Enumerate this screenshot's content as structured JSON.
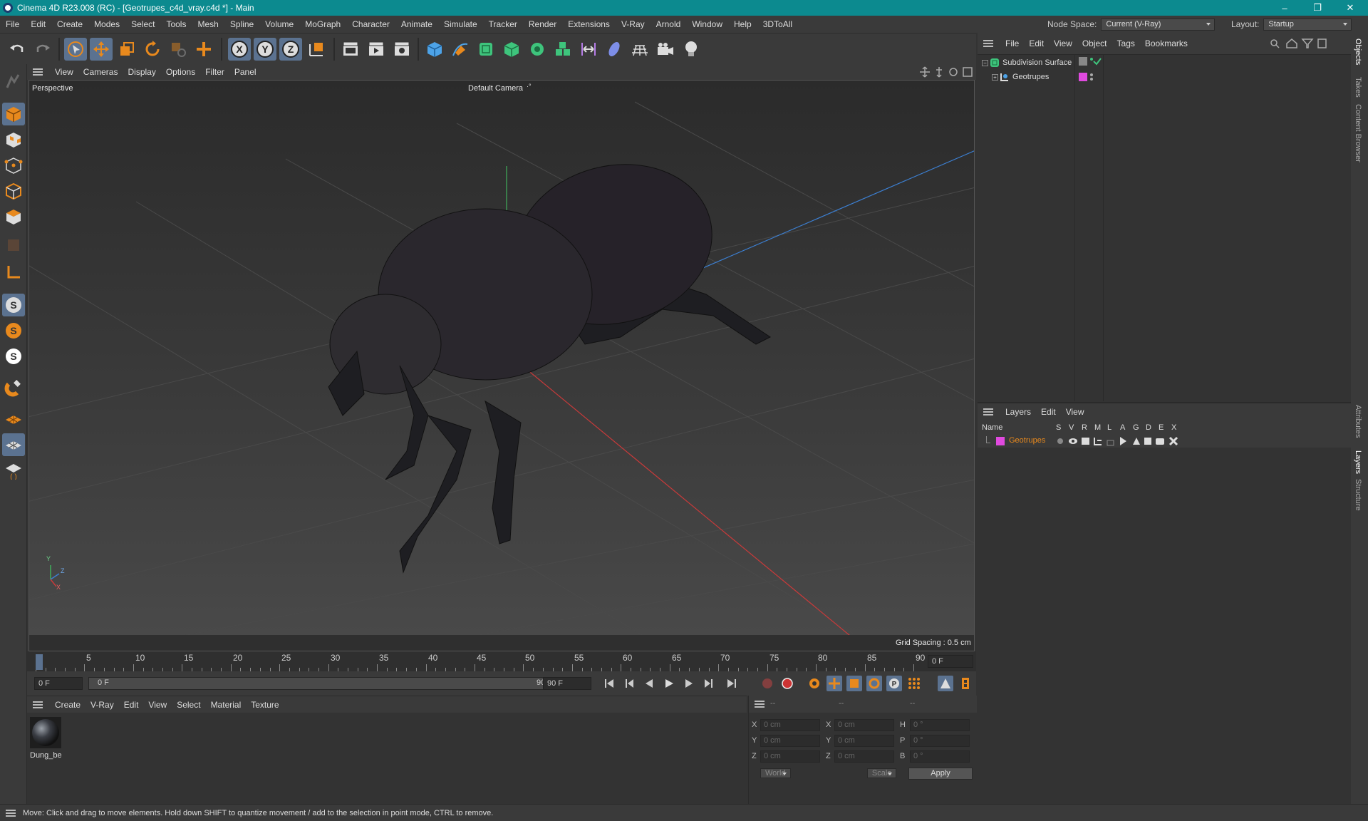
{
  "window": {
    "title": "Cinema 4D R23.008 (RC) - [Geotrupes_c4d_vray.c4d *] - Main",
    "minimize": "–",
    "restore": "❐",
    "close": "✕"
  },
  "menu": {
    "items": [
      "File",
      "Edit",
      "Create",
      "Modes",
      "Select",
      "Tools",
      "Mesh",
      "Spline",
      "Volume",
      "MoGraph",
      "Character",
      "Animate",
      "Simulate",
      "Tracker",
      "Render",
      "Extensions",
      "V-Ray",
      "Arnold",
      "Window",
      "Help",
      "3DToAll"
    ],
    "node_space_label": "Node Space:",
    "node_space_value": "Current (V-Ray)",
    "layout_label": "Layout:",
    "layout_value": "Startup"
  },
  "viewport": {
    "menu": [
      "View",
      "Cameras",
      "Display",
      "Options",
      "Filter",
      "Panel"
    ],
    "projection": "Perspective",
    "camera": "Default Camera",
    "camera_mark": "·°",
    "grid_spacing": "Grid Spacing : 0.5 cm",
    "axis_y": "Y",
    "axis_z": "Z",
    "axis_x": "X"
  },
  "timeline": {
    "ticks": [
      "0",
      "5",
      "10",
      "15",
      "20",
      "25",
      "30",
      "35",
      "40",
      "45",
      "50",
      "55",
      "60",
      "65",
      "70",
      "75",
      "80",
      "85",
      "90"
    ],
    "current_frame": "0 F",
    "start_field": "0 F",
    "range_start": "0 F",
    "range_end": "90 F",
    "end_field": "90 F"
  },
  "materials": {
    "menu": [
      "Create",
      "V-Ray",
      "Edit",
      "View",
      "Select",
      "Material",
      "Texture"
    ],
    "items": [
      {
        "label": "Dung_be"
      }
    ]
  },
  "coordinates": {
    "headers": [
      "--",
      "--",
      "--"
    ],
    "rows": [
      {
        "l1": "X",
        "v1": "0 cm",
        "l2": "X",
        "v2": "0 cm",
        "l3": "H",
        "v3": "0 °"
      },
      {
        "l1": "Y",
        "v1": "0 cm",
        "l2": "Y",
        "v2": "0 cm",
        "l3": "P",
        "v3": "0 °"
      },
      {
        "l1": "Z",
        "v1": "0 cm",
        "l2": "Z",
        "v2": "0 cm",
        "l3": "B",
        "v3": "0 °"
      }
    ],
    "space": "World",
    "mode": "Scale",
    "apply": "Apply"
  },
  "objects": {
    "menu": [
      "File",
      "Edit",
      "View",
      "Object",
      "Tags",
      "Bookmarks"
    ],
    "items": [
      {
        "name": "Subdivision Surface"
      },
      {
        "name": "Geotrupes"
      }
    ]
  },
  "layers": {
    "menu": [
      "Layers",
      "Edit",
      "View"
    ],
    "columns": [
      "Name",
      "S",
      "V",
      "R",
      "M",
      "L",
      "A",
      "G",
      "D",
      "E",
      "X"
    ],
    "items": [
      {
        "name": "Geotrupes",
        "color": "#e04adf"
      }
    ]
  },
  "right_tabs": [
    "Objects",
    "Takes",
    "Content Browser",
    "Attributes",
    "Layers",
    "Structure"
  ],
  "status": "Move: Click and drag to move elements. Hold down SHIFT to quantize movement / add to the selection in point mode, CTRL to remove.",
  "colors": {
    "accent": "#e8891d",
    "selected": "#5b7290",
    "layer": "#e04adf"
  }
}
